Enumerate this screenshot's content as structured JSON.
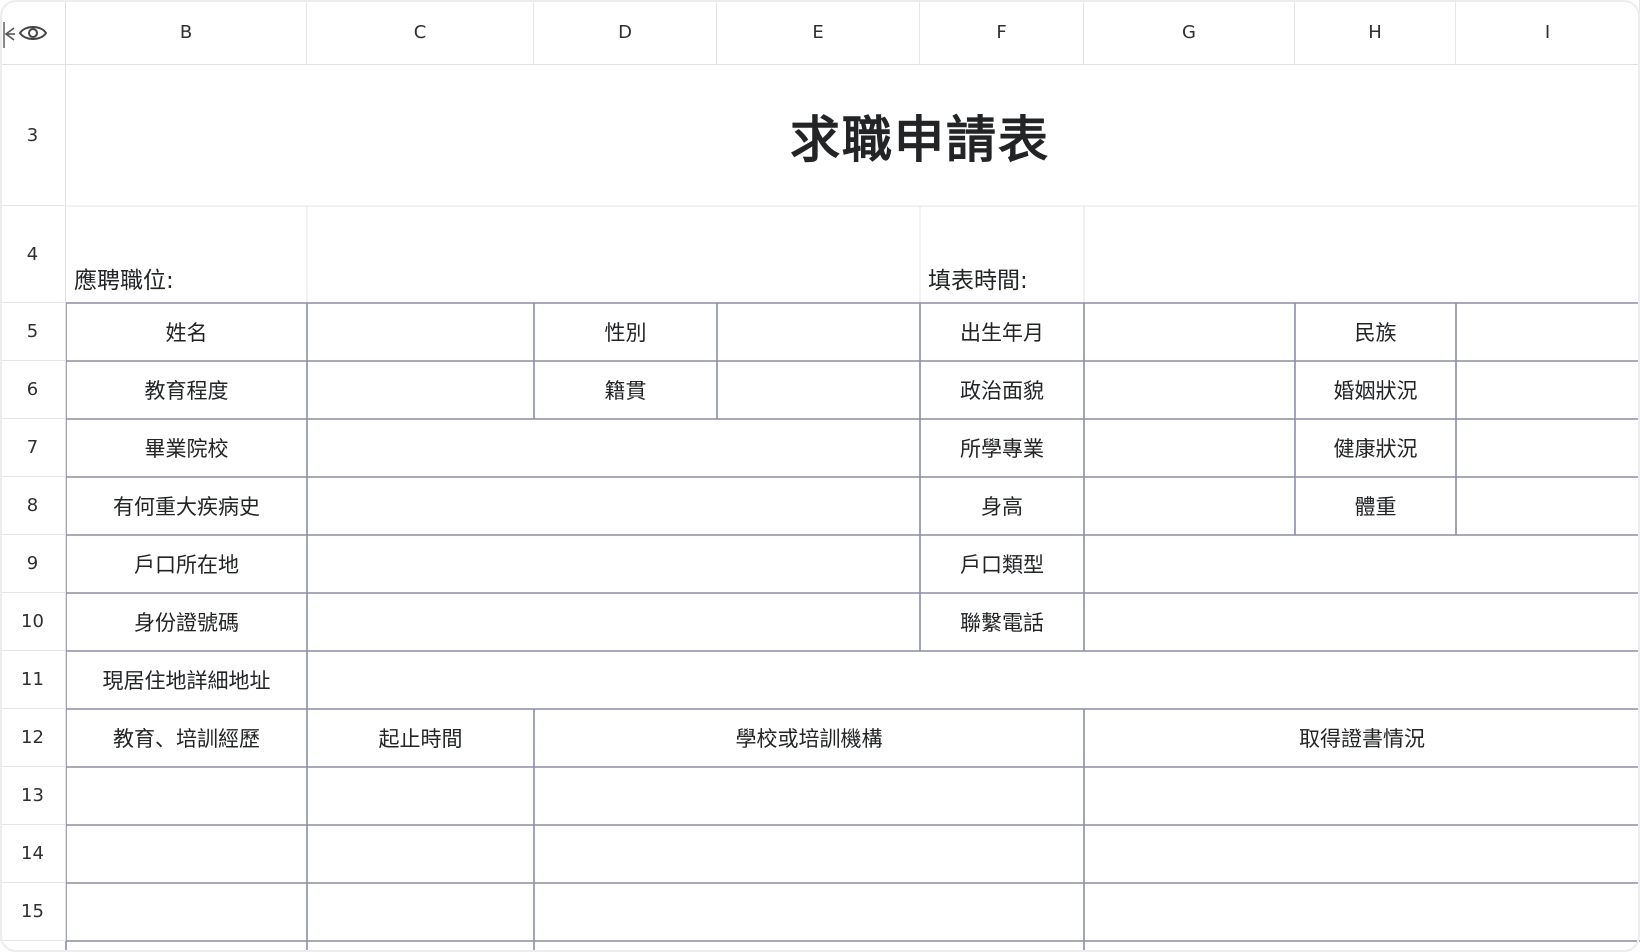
{
  "columns": [
    "B",
    "C",
    "D",
    "E",
    "F",
    "G",
    "H",
    "I"
  ],
  "rows": [
    "3",
    "4",
    "5",
    "6",
    "7",
    "8",
    "9",
    "10",
    "11",
    "12",
    "13",
    "14",
    "15"
  ],
  "form": {
    "title": "求職申請表",
    "position_label": "應聘職位:",
    "fill_time_label": "填表時間:",
    "labels": {
      "name": "姓名",
      "gender": "性別",
      "birth": "出生年月",
      "ethnicity": "民族",
      "education": "教育程度",
      "native_place": "籍貫",
      "political_status": "政治面貌",
      "marital_status": "婚姻狀況",
      "school": "畢業院校",
      "major": "所學專業",
      "health": "健康狀況",
      "medical_history": "有何重大疾病史",
      "height": "身高",
      "weight": "體重",
      "household_location": "戶口所在地",
      "household_type": "戶口類型",
      "id_number": "身份證號碼",
      "phone": "聯繫電話",
      "address": "現居住地詳細地址",
      "training_history": "教育、培訓經歷",
      "period": "起止時間",
      "institution": "學校或培訓機構",
      "certificates": "取得證書情況"
    }
  },
  "colors": {
    "form_border": "#8b8ea6",
    "grid_light": "#e6e6e6",
    "text": "#222426"
  },
  "icons": [
    "collapse-arrow-icon",
    "eye-icon"
  ]
}
